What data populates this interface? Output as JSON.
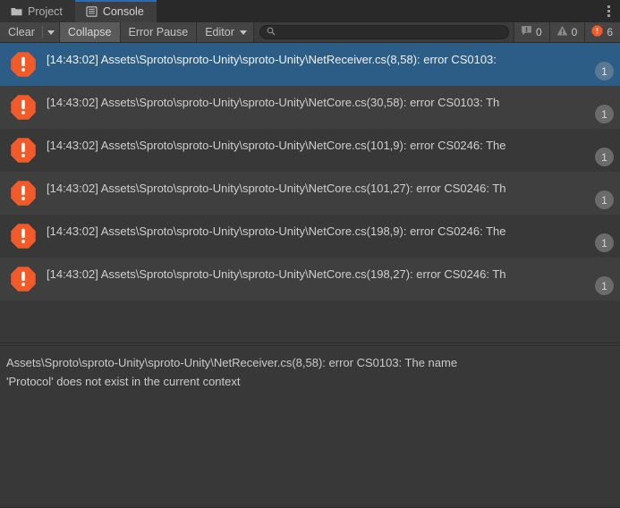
{
  "window": {
    "app": "Unity Editor",
    "panel_title": "Console"
  },
  "tabs": [
    {
      "label": "Project",
      "icon": "folder-icon",
      "active": false
    },
    {
      "label": "Console",
      "icon": "console-icon",
      "active": true
    }
  ],
  "menu": {
    "kebab_icon": "kebab-menu-icon"
  },
  "toolbar": {
    "clear_label": "Clear",
    "clear_dropdown_icon": "chevron-down-icon",
    "collapse_label": "Collapse",
    "collapse_pressed": true,
    "error_pause_label": "Error Pause",
    "error_pause_pressed": false,
    "editor_label": "Editor",
    "editor_dropdown_icon": "chevron-down-icon",
    "search": {
      "icon": "search-icon",
      "value": "",
      "placeholder": ""
    },
    "counters": [
      {
        "icon": "log-bubble-icon",
        "count": "0",
        "name": "log-count"
      },
      {
        "icon": "warning-triangle-icon",
        "count": "0",
        "name": "warning-count"
      },
      {
        "icon": "error-octagon-icon",
        "count": "6",
        "name": "error-count"
      }
    ]
  },
  "colors": {
    "error_orange": "#f15a29",
    "selection_blue": "#2c5d87",
    "tab_accent": "#2b6cb5",
    "panel_bg": "#383838",
    "row_alt_bg": "#3f3f3f",
    "toolbar_bg": "#3c3c3c"
  },
  "log_entries": [
    {
      "icon": "error-octagon-icon",
      "timestamp": "[14:43:02]",
      "text": "[14:43:02] Assets\\Sproto\\sproto-Unity\\sproto-Unity\\NetReceiver.cs(8,58): error CS0103:",
      "badge": "1",
      "selected": true
    },
    {
      "icon": "error-octagon-icon",
      "timestamp": "[14:43:02]",
      "text": "[14:43:02] Assets\\Sproto\\sproto-Unity\\sproto-Unity\\NetCore.cs(30,58): error CS0103: Th",
      "badge": "1",
      "selected": false
    },
    {
      "icon": "error-octagon-icon",
      "timestamp": "[14:43:02]",
      "text": "[14:43:02] Assets\\Sproto\\sproto-Unity\\sproto-Unity\\NetCore.cs(101,9): error CS0246: The",
      "badge": "1",
      "selected": false
    },
    {
      "icon": "error-octagon-icon",
      "timestamp": "[14:43:02]",
      "text": "[14:43:02] Assets\\Sproto\\sproto-Unity\\sproto-Unity\\NetCore.cs(101,27): error CS0246: Th",
      "badge": "1",
      "selected": false
    },
    {
      "icon": "error-octagon-icon",
      "timestamp": "[14:43:02]",
      "text": "[14:43:02] Assets\\Sproto\\sproto-Unity\\sproto-Unity\\NetCore.cs(198,9): error CS0246: The",
      "badge": "1",
      "selected": false
    },
    {
      "icon": "error-octagon-icon",
      "timestamp": "[14:43:02]",
      "text": "[14:43:02] Assets\\Sproto\\sproto-Unity\\sproto-Unity\\NetCore.cs(198,27): error CS0246: Th",
      "badge": "1",
      "selected": false
    }
  ],
  "detail": {
    "text": "Assets\\Sproto\\sproto-Unity\\sproto-Unity\\NetReceiver.cs(8,58): error CS0103: The name\n'Protocol' does not exist in the current context"
  }
}
